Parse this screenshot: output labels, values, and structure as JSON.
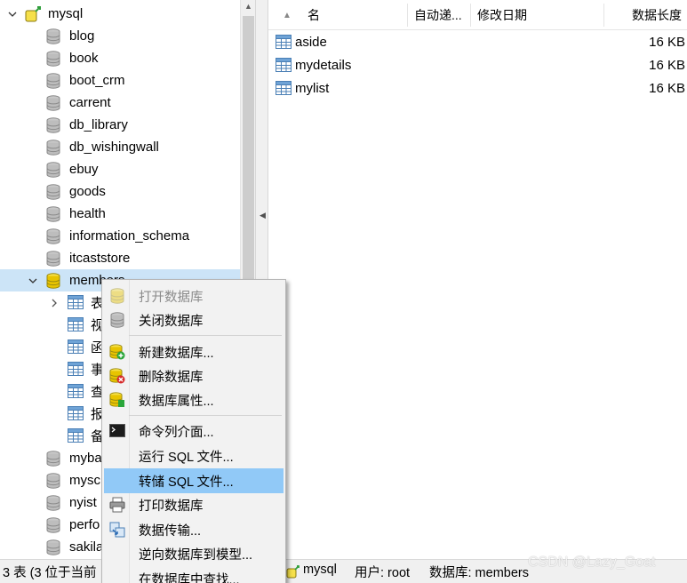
{
  "tree": {
    "connection": "mysql",
    "databases": [
      "blog",
      "book",
      "boot_crm",
      "carrent",
      "db_library",
      "db_wishingwall",
      "ebuy",
      "goods",
      "health",
      "information_schema",
      "itcaststore"
    ],
    "selected_db": "members",
    "children": [
      "表",
      "视",
      "函",
      "事",
      "查",
      "报",
      "备"
    ],
    "more_dbs": [
      "myba",
      "mysc",
      "nyist",
      "perfo",
      "sakila"
    ]
  },
  "columns": {
    "name": "名",
    "auto": "自动递...",
    "modified": "修改日期",
    "size": "数据长度"
  },
  "tables": [
    {
      "name": "aside",
      "size": "16 KB"
    },
    {
      "name": "mydetails",
      "size": "16 KB"
    },
    {
      "name": "mylist",
      "size": "16 KB"
    }
  ],
  "menu": {
    "open_db": "打开数据库",
    "close_db": "关闭数据库",
    "new_db": "新建数据库...",
    "delete_db": "删除数据库",
    "db_props": "数据库属性...",
    "cmd_console": "命令列介面...",
    "run_sql": "运行 SQL 文件...",
    "dump_sql": "转储 SQL 文件...",
    "print_db": "打印数据库",
    "transfer": "数据传输...",
    "reverse_model": "逆向数据库到模型...",
    "find_in_db": "在数据库中查找..."
  },
  "status": {
    "count": "3 表 (3 位于当前",
    "conn": "mysql",
    "user": "用户: root",
    "db": "数据库: members"
  },
  "watermark": "CSDN @Lazy_Goat",
  "colors": {
    "selection": "#cce4f7",
    "menu_highlight": "#91c9f7",
    "db_active": "#e8c400"
  }
}
